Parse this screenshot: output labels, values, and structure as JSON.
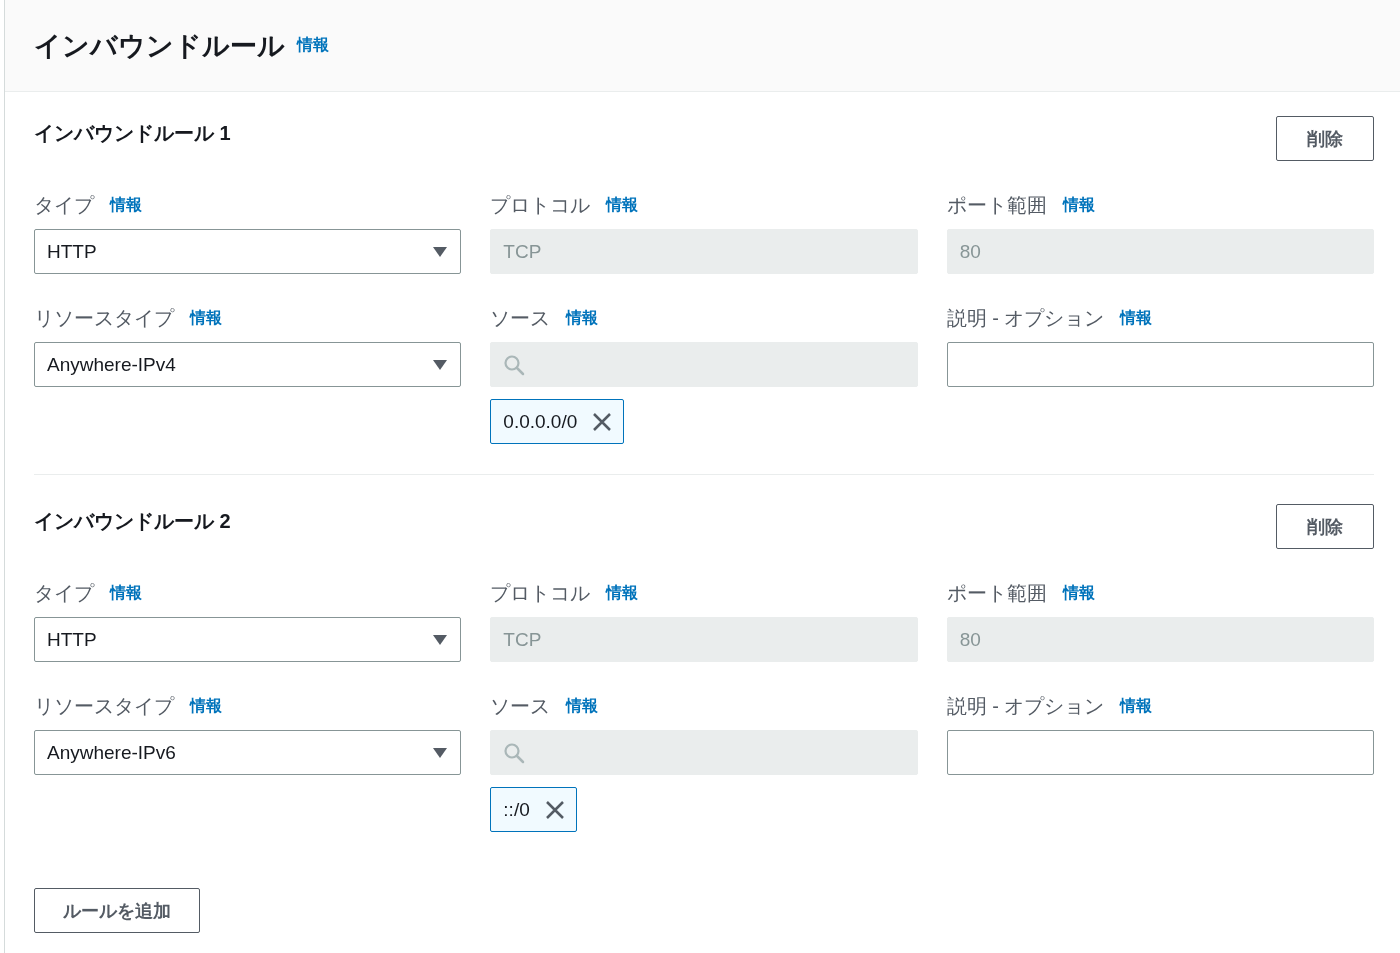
{
  "header": {
    "title": "インバウンドルール",
    "info": "情報"
  },
  "rules": [
    {
      "title": "インバウンドルール 1",
      "delete_button": "削除",
      "fields": [
        {
          "label": "タイプ",
          "info": "情報",
          "kind": "select",
          "value": "HTTP"
        },
        {
          "label": "プロトコル",
          "info": "情報",
          "kind": "readonly",
          "value": "TCP"
        },
        {
          "label": "ポート範囲",
          "info": "情報",
          "kind": "readonly",
          "value": "80"
        },
        {
          "label": "リソースタイプ",
          "info": "情報",
          "kind": "select",
          "value": "Anywhere-IPv4"
        },
        {
          "label": "ソース",
          "info": "情報",
          "kind": "search",
          "tokens": [
            "0.0.0.0/0"
          ]
        },
        {
          "label": "説明 - オプション",
          "info": "情報",
          "kind": "text"
        }
      ]
    },
    {
      "title": "インバウンドルール 2",
      "delete_button": "削除",
      "fields": [
        {
          "label": "タイプ",
          "info": "情報",
          "kind": "select",
          "value": "HTTP"
        },
        {
          "label": "プロトコル",
          "info": "情報",
          "kind": "readonly",
          "value": "TCP"
        },
        {
          "label": "ポート範囲",
          "info": "情報",
          "kind": "readonly",
          "value": "80"
        },
        {
          "label": "リソースタイプ",
          "info": "情報",
          "kind": "select",
          "value": "Anywhere-IPv6"
        },
        {
          "label": "ソース",
          "info": "情報",
          "kind": "search",
          "tokens": [
            "::/0"
          ]
        },
        {
          "label": "説明 - オプション",
          "info": "情報",
          "kind": "text"
        }
      ]
    }
  ],
  "add_button": "ルールを追加"
}
